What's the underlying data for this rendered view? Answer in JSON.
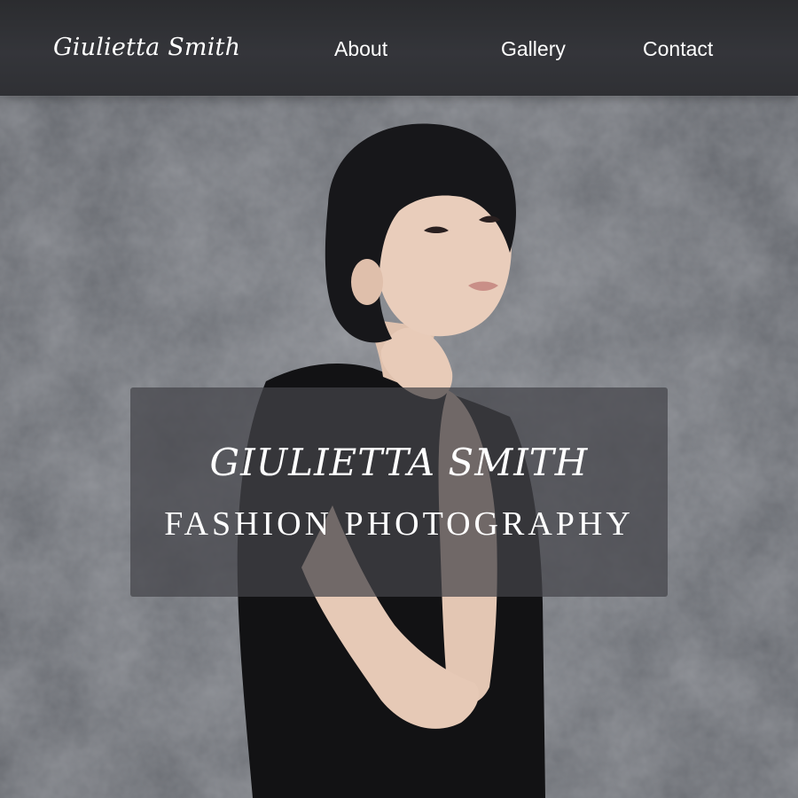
{
  "nav": {
    "brand": "Giulietta Smith",
    "links": [
      "About",
      "Gallery",
      "Contact"
    ]
  },
  "hero": {
    "title": "GIULIETTA SMITH",
    "subtitle": "FASHION PHOTOGRAPHY"
  },
  "colors": {
    "navbar": "#2f3034",
    "background": "#6d7076",
    "hero_overlay": "#44444a",
    "text": "#ffffff"
  }
}
